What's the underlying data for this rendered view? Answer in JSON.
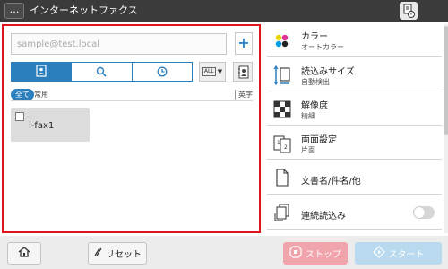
{
  "titlebar": {
    "menu_label": "…",
    "title": "インターネットファクス"
  },
  "address": {
    "placeholder": "sample@test.local",
    "add_label": "+"
  },
  "search_tabs": [
    {
      "icon": "address-book-icon",
      "active": true
    },
    {
      "icon": "search-icon",
      "active": false
    },
    {
      "icon": "history-clock-icon",
      "active": false
    }
  ],
  "all_dropdown": {
    "label": "ALL",
    "arrow": "▼"
  },
  "filters": {
    "all": "全て",
    "common": "常用",
    "alphabet": "英字"
  },
  "destinations": [
    {
      "name": "i-fax1",
      "checked": false
    }
  ],
  "settings": [
    {
      "icon": "color-dots-icon",
      "label": "カラー",
      "value": "オートカラー"
    },
    {
      "icon": "scan-size-icon",
      "label": "読込みサイズ",
      "value": "自動検出"
    },
    {
      "icon": "resolution-icon",
      "label": "解像度",
      "value": "精細"
    },
    {
      "icon": "duplex-icon",
      "label": "両面設定",
      "value": "片面"
    },
    {
      "icon": "document-name-icon",
      "label": "文書名/件名/他",
      "value": ""
    },
    {
      "icon": "continuous-scan-icon",
      "label": "連続読込み",
      "value": "",
      "toggle": false
    }
  ],
  "bottom": {
    "reset_label": "リセット",
    "stop_label": "ストップ",
    "start_label": "スタート"
  },
  "colors": {
    "accent": "#2c7fbd",
    "highlight_border": "#e0141c",
    "stop": "#f0a4ab",
    "start": "#b8d9ee"
  }
}
